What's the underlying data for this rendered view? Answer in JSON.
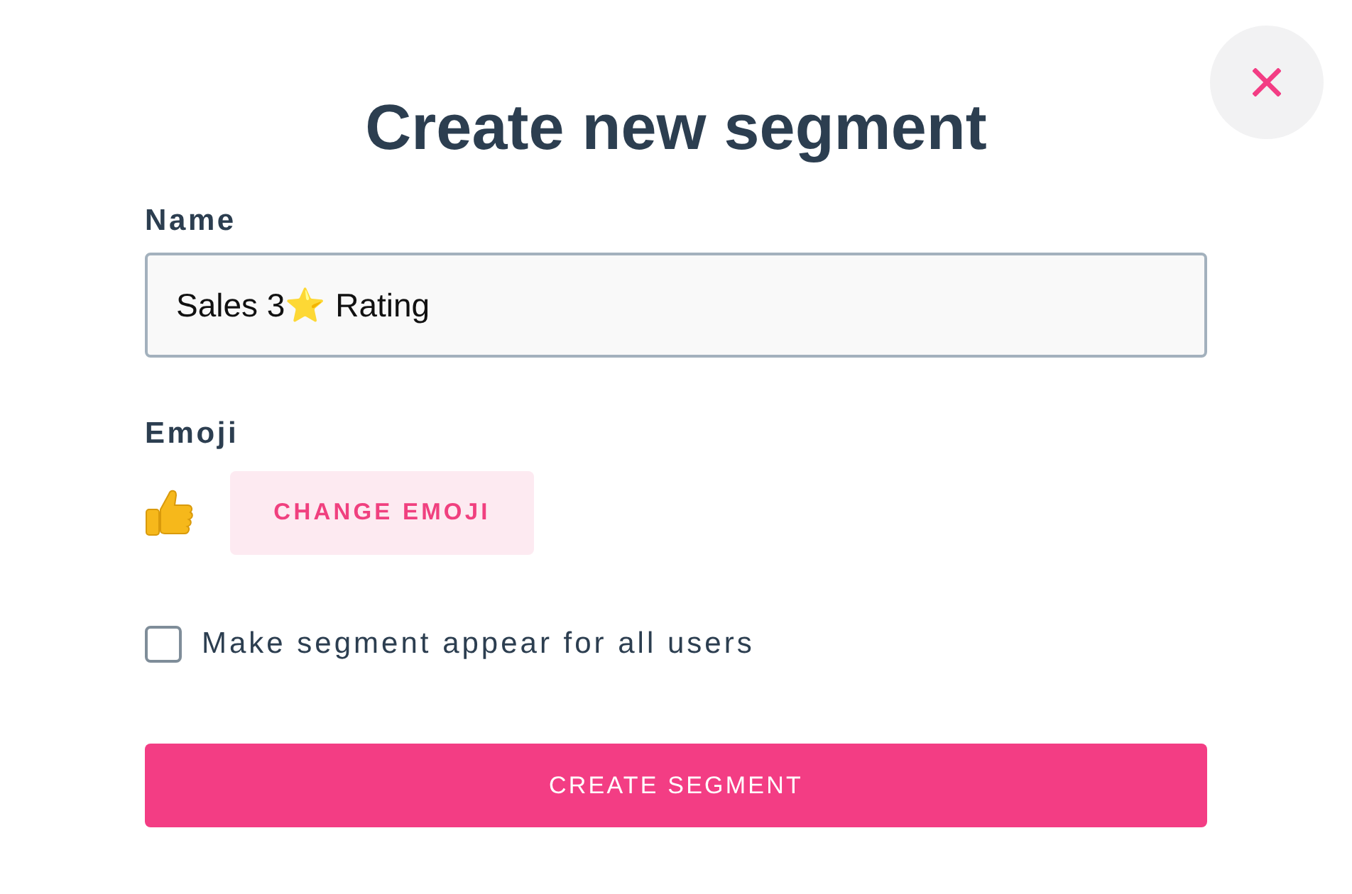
{
  "title": "Create new segment",
  "name_field": {
    "label": "Name",
    "value": "Sales 3⭐ Rating"
  },
  "emoji_field": {
    "label": "Emoji",
    "button": "CHANGE EMOJI"
  },
  "all_users_option": {
    "label": "Make segment appear for all users",
    "checked": false
  },
  "submit_button": "CREATE SEGMENT"
}
